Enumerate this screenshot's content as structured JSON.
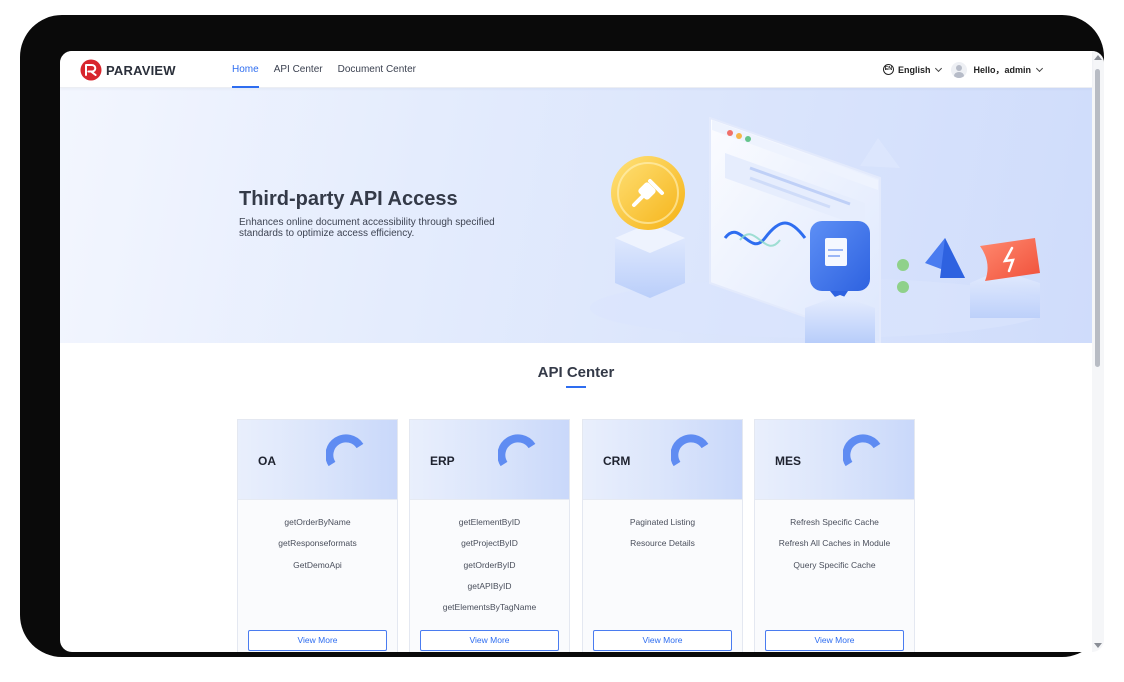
{
  "brand": {
    "name": "PARAVIEW",
    "logo_icon": "paraview-logo-icon"
  },
  "nav": {
    "items": [
      {
        "label": "Home",
        "active": true
      },
      {
        "label": "API Center",
        "active": false
      },
      {
        "label": "Document Center",
        "active": false
      }
    ]
  },
  "header": {
    "language": {
      "icon": "language-globe-icon",
      "label": "English"
    },
    "user": {
      "icon": "user-avatar-icon",
      "greeting": "Hello，admin"
    }
  },
  "hero": {
    "title": "Third-party API Access",
    "subtitle": "Enhances online document accessibility through specified standards to optimize access efficiency."
  },
  "api_center": {
    "title": "API Center",
    "cards": [
      {
        "name": "OA",
        "items": [
          "getOrderByName",
          "getResponseformats",
          "GetDemoApi"
        ],
        "button": "View More"
      },
      {
        "name": "ERP",
        "items": [
          "getElementByID",
          "getProjectByID",
          "getOrderByID",
          "getAPIByID",
          "getElementsByTagName"
        ],
        "button": "View More"
      },
      {
        "name": "CRM",
        "items": [
          "Paginated Listing",
          "Resource Details"
        ],
        "button": "View More"
      },
      {
        "name": "MES",
        "items": [
          "Refresh Specific Cache",
          "Refresh All Caches in Module",
          "Query Specific Cache"
        ],
        "button": "View More"
      }
    ]
  },
  "colors": {
    "accent": "#2e6df0",
    "hero_start": "#f3f6fe",
    "hero_end": "#cfdcfb",
    "device_frame": "#0a0a0a"
  }
}
